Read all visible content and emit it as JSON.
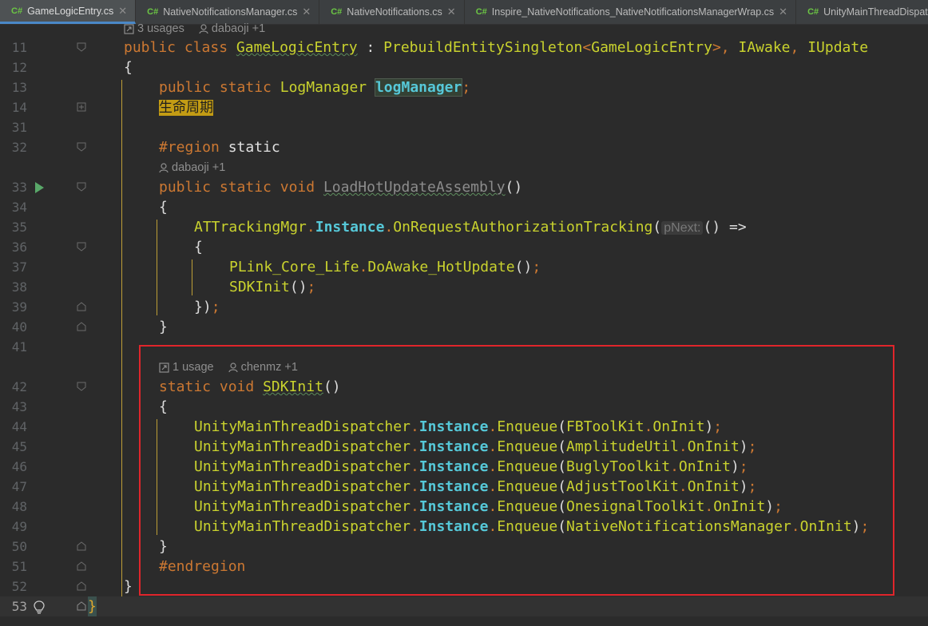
{
  "tabs": [
    {
      "label": "GameLogicEntry.cs",
      "lang": "C#",
      "active": true
    },
    {
      "label": "NativeNotificationsManager.cs",
      "lang": "C#",
      "active": false
    },
    {
      "label": "NativeNotifications.cs",
      "lang": "C#",
      "active": false
    },
    {
      "label": "Inspire_NativeNotifications_NativeNotificationsManagerWrap.cs",
      "lang": "C#",
      "active": false
    },
    {
      "label": "UnityMainThreadDispat",
      "lang": "C#",
      "active": false
    }
  ],
  "hints": {
    "class_usages": "3 usages",
    "class_author": "dabaoji +1",
    "load_author": "dabaoji +1",
    "sdk_usages": "1 usage",
    "sdk_author": "chenmz +1"
  },
  "line_numbers": [
    "11",
    "12",
    "13",
    "14",
    "31",
    "32",
    "33",
    "34",
    "35",
    "36",
    "37",
    "38",
    "39",
    "40",
    "41",
    "42",
    "43",
    "44",
    "45",
    "46",
    "47",
    "48",
    "49",
    "50",
    "51",
    "52",
    "53"
  ],
  "code": {
    "l11": {
      "kw1": "public",
      "kw2": "class",
      "name": "GameLogicEntry",
      "colon": " : ",
      "base": "PrebuildEntitySingleton",
      "lt": "<",
      "gen": "GameLogicEntry",
      "gt": ">",
      "c1": ", ",
      "i1": "IAwake",
      "c2": ", ",
      "i2": "IUpdate"
    },
    "l12": "{",
    "l13": {
      "kw1": "public",
      "kw2": "static",
      "type": "LogManager",
      "field": "logManager",
      "semi": ";"
    },
    "l14": "生命周期",
    "l32": {
      "region": "#region",
      "name": "static"
    },
    "l33": {
      "kw1": "public",
      "kw2": "static",
      "kw3": "void",
      "name": "LoadHotUpdateAssembly",
      "parens": "()"
    },
    "l34": "{",
    "l35": {
      "cls": "ATTrackingMgr",
      "dot1": ".",
      "prop": "Instance",
      "dot2": ".",
      "mth": "OnRequestAuthorizationTracking",
      "open": "(",
      "param": "pNext:",
      "rest": "() =>"
    },
    "l36": "{",
    "l37": {
      "cls": "PLink_Core_Life",
      "dot": ".",
      "mth": "DoAwake_HotUpdate",
      "parens": "()",
      "semi": ";"
    },
    "l38": {
      "mth": "SDKInit",
      "parens": "()",
      "semi": ";"
    },
    "l39": {
      "close": "})",
      "semi": ";"
    },
    "l40": "}",
    "l42": {
      "kw1": "static",
      "kw2": "void",
      "name": "SDKInit",
      "parens": "()"
    },
    "l43": "{",
    "enqueue_lines": [
      {
        "cls": "UnityMainThreadDispatcher",
        "prop": "Instance",
        "mth": "Enqueue",
        "arg_cls": "FBToolKit",
        "arg_mth": "OnInit"
      },
      {
        "cls": "UnityMainThreadDispatcher",
        "prop": "Instance",
        "mth": "Enqueue",
        "arg_cls": "AmplitudeUtil",
        "arg_mth": "OnInit"
      },
      {
        "cls": "UnityMainThreadDispatcher",
        "prop": "Instance",
        "mth": "Enqueue",
        "arg_cls": "BuglyToolkit",
        "arg_mth": "OnInit"
      },
      {
        "cls": "UnityMainThreadDispatcher",
        "prop": "Instance",
        "mth": "Enqueue",
        "arg_cls": "AdjustToolKit",
        "arg_mth": "OnInit"
      },
      {
        "cls": "UnityMainThreadDispatcher",
        "prop": "Instance",
        "mth": "Enqueue",
        "arg_cls": "OnesignalToolkit",
        "arg_mth": "OnInit"
      },
      {
        "cls": "UnityMainThreadDispatcher",
        "prop": "Instance",
        "mth": "Enqueue",
        "arg_cls": "NativeNotificationsManager",
        "arg_mth": "OnInit"
      }
    ],
    "l50": "}",
    "l51": "#endregion",
    "l52": "}",
    "l53": "}"
  },
  "colors": {
    "keyword": "#cc7832",
    "class": "#c9d22e",
    "property": "#56c8d8",
    "highlight_box": "#e0252b",
    "active_tab_underline": "#4a88c7"
  }
}
